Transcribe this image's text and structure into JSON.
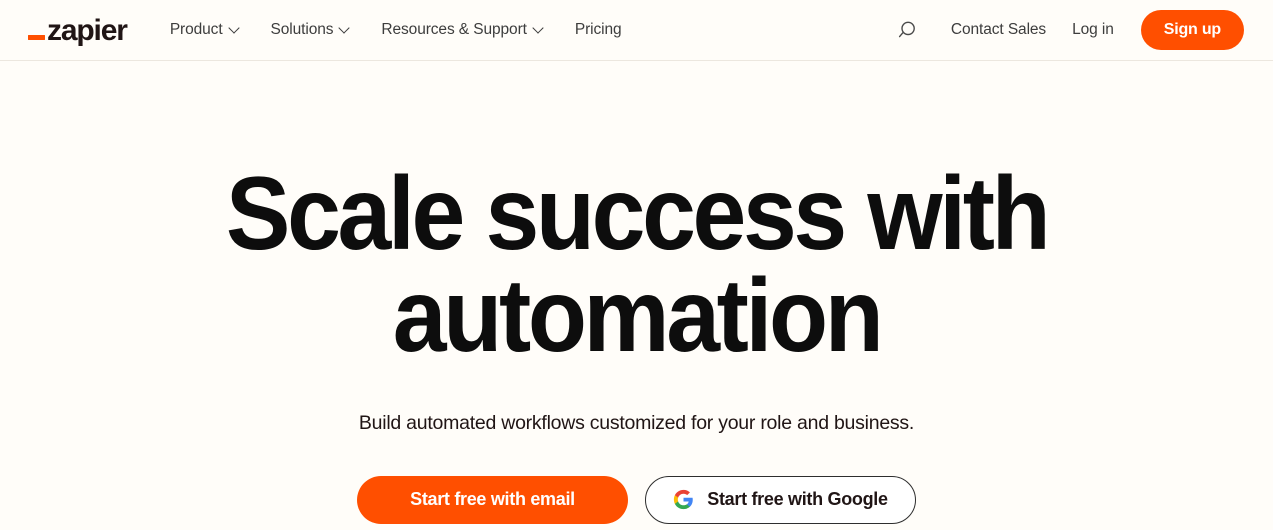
{
  "brand": {
    "name": "zapier",
    "logo_mark": "underscore-mark",
    "accent_color": "#FF4F00",
    "page_background": "#FFFDF9",
    "text_color": "#201515"
  },
  "header": {
    "nav": [
      {
        "label": "Product",
        "has_dropdown": true,
        "icon": "chevron-down-icon"
      },
      {
        "label": "Solutions",
        "has_dropdown": true,
        "icon": "chevron-down-icon"
      },
      {
        "label": "Resources & Support",
        "has_dropdown": true,
        "icon": "chevron-down-icon"
      },
      {
        "label": "Pricing",
        "has_dropdown": false,
        "icon": ""
      }
    ],
    "search": {
      "icon": "search-icon",
      "label": "Search"
    },
    "contact_sales": "Contact Sales",
    "log_in": "Log in",
    "sign_up": "Sign up"
  },
  "hero": {
    "title_line_1": "Scale success with",
    "title_line_2": "automation",
    "subtitle": "Build automated workflows customized for your role and business.",
    "cta_primary": "Start free with email",
    "cta_secondary": "Start free with Google",
    "cta_secondary_icon": "google-g-icon"
  },
  "google_colors": {
    "red": "#EA4335",
    "yellow": "#FBBC05",
    "green": "#34A853",
    "blue": "#4285F4"
  }
}
